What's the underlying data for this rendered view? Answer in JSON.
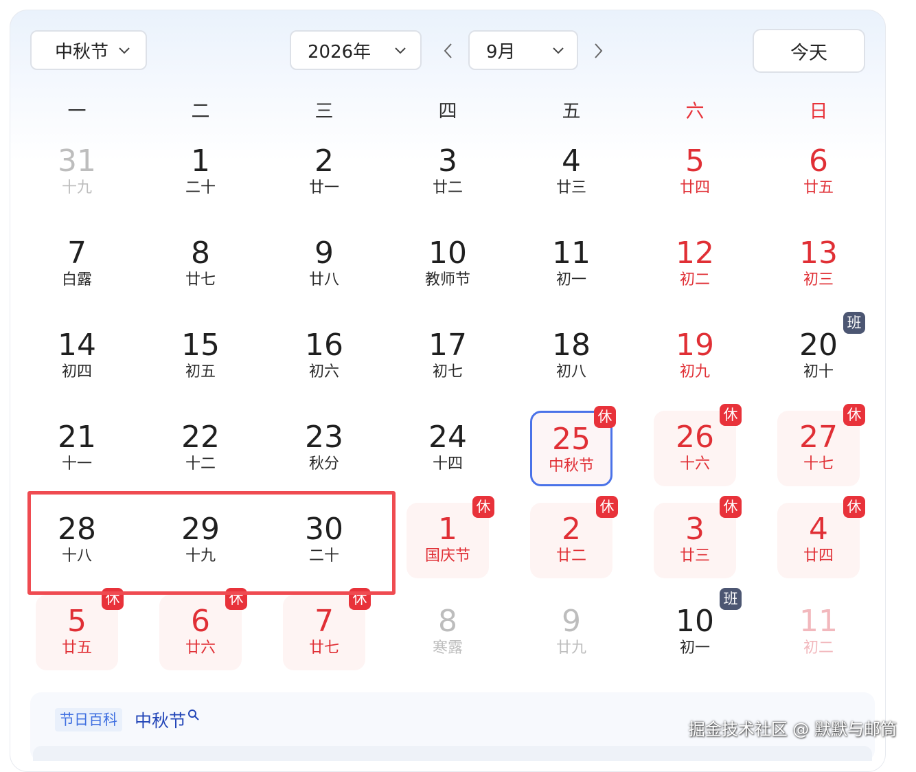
{
  "toolbar": {
    "holiday_select": "中秋节",
    "year_select": "2026年",
    "month_select": "9月",
    "today_button": "今天"
  },
  "weekdays": [
    "一",
    "二",
    "三",
    "四",
    "五",
    "六",
    "日"
  ],
  "weekend_color": "#e8333a",
  "accent_selected_border": "#4a72e8",
  "highlight_box_color": "#ef4b51",
  "days": [
    {
      "num": "31",
      "sub": "十九",
      "state": "grey"
    },
    {
      "num": "1",
      "sub": "二十",
      "state": "normal"
    },
    {
      "num": "2",
      "sub": "廿一",
      "state": "normal"
    },
    {
      "num": "3",
      "sub": "廿二",
      "state": "normal"
    },
    {
      "num": "4",
      "sub": "廿三",
      "state": "normal"
    },
    {
      "num": "5",
      "sub": "廿四",
      "state": "red"
    },
    {
      "num": "6",
      "sub": "廿五",
      "state": "red"
    },
    {
      "num": "7",
      "sub": "白露",
      "state": "normal"
    },
    {
      "num": "8",
      "sub": "廿七",
      "state": "normal"
    },
    {
      "num": "9",
      "sub": "廿八",
      "state": "normal"
    },
    {
      "num": "10",
      "sub": "教师节",
      "state": "normal"
    },
    {
      "num": "11",
      "sub": "初一",
      "state": "normal"
    },
    {
      "num": "12",
      "sub": "初二",
      "state": "red"
    },
    {
      "num": "13",
      "sub": "初三",
      "state": "red"
    },
    {
      "num": "14",
      "sub": "初四",
      "state": "normal"
    },
    {
      "num": "15",
      "sub": "初五",
      "state": "normal"
    },
    {
      "num": "16",
      "sub": "初六",
      "state": "normal"
    },
    {
      "num": "17",
      "sub": "初七",
      "state": "normal"
    },
    {
      "num": "18",
      "sub": "初八",
      "state": "normal"
    },
    {
      "num": "19",
      "sub": "初九",
      "state": "red"
    },
    {
      "num": "20",
      "sub": "初十",
      "state": "normal",
      "badge": "班"
    },
    {
      "num": "21",
      "sub": "十一",
      "state": "normal"
    },
    {
      "num": "22",
      "sub": "十二",
      "state": "normal"
    },
    {
      "num": "23",
      "sub": "秋分",
      "state": "normal"
    },
    {
      "num": "24",
      "sub": "十四",
      "state": "normal"
    },
    {
      "num": "25",
      "sub": "中秋节",
      "state": "red",
      "selected": true,
      "badge": "休"
    },
    {
      "num": "26",
      "sub": "十六",
      "state": "red",
      "rest": true,
      "badge": "休"
    },
    {
      "num": "27",
      "sub": "十七",
      "state": "red",
      "rest": true,
      "badge": "休"
    },
    {
      "num": "28",
      "sub": "十八",
      "state": "normal"
    },
    {
      "num": "29",
      "sub": "十九",
      "state": "normal"
    },
    {
      "num": "30",
      "sub": "二十",
      "state": "normal"
    },
    {
      "num": "1",
      "sub": "国庆节",
      "state": "red",
      "rest": true,
      "badge": "休"
    },
    {
      "num": "2",
      "sub": "廿二",
      "state": "red",
      "rest": true,
      "badge": "休"
    },
    {
      "num": "3",
      "sub": "廿三",
      "state": "red",
      "rest": true,
      "badge": "休"
    },
    {
      "num": "4",
      "sub": "廿四",
      "state": "red",
      "rest": true,
      "badge": "休"
    },
    {
      "num": "5",
      "sub": "廿五",
      "state": "red",
      "rest": true,
      "badge": "休"
    },
    {
      "num": "6",
      "sub": "廿六",
      "state": "red",
      "rest": true,
      "badge": "休"
    },
    {
      "num": "7",
      "sub": "廿七",
      "state": "red",
      "rest": true,
      "badge": "休"
    },
    {
      "num": "8",
      "sub": "寒露",
      "state": "grey"
    },
    {
      "num": "9",
      "sub": "廿九",
      "state": "grey"
    },
    {
      "num": "10",
      "sub": "初一",
      "state": "normal",
      "badge": "班"
    },
    {
      "num": "11",
      "sub": "初二",
      "state": "pink"
    }
  ],
  "info": {
    "tag": "节日百科",
    "festival": "中秋节"
  },
  "watermark": "掘金技术社区 @ 默默与邮筒"
}
